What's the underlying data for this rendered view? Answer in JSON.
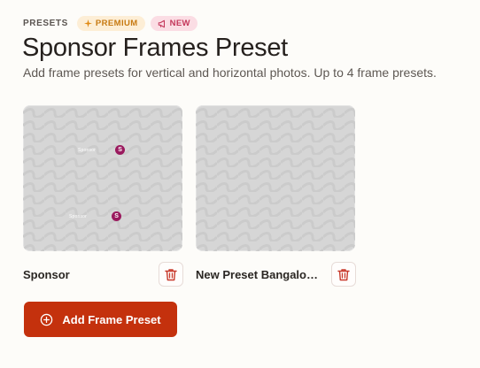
{
  "breadcrumb": {
    "label": "PRESETS",
    "badges": [
      {
        "label": "PREMIUM",
        "icon": "sparkle-icon",
        "color": "#c77a12"
      },
      {
        "label": "NEW",
        "icon": "megaphone-icon",
        "color": "#c4365a"
      }
    ]
  },
  "page": {
    "title": "Sponsor Frames Preset",
    "subtitle": "Add frame presets for vertical and horizontal photos. Up to 4 frame presets."
  },
  "presets": [
    {
      "name": "Sponsor",
      "markers": [
        {
          "label": "Sponsor",
          "icon_text": "S"
        },
        {
          "label": "Sponsor",
          "icon_text": "S"
        }
      ],
      "delete_icon": "trash-icon"
    },
    {
      "name": "New Preset Bangalor...",
      "markers": [],
      "delete_icon": "trash-icon"
    }
  ],
  "actions": {
    "add_label": "Add Frame Preset",
    "add_icon": "plus-circle-icon"
  },
  "colors": {
    "accent": "#c4310d",
    "marker": "#9a1a5e",
    "delete_icon": "#c8392b"
  }
}
